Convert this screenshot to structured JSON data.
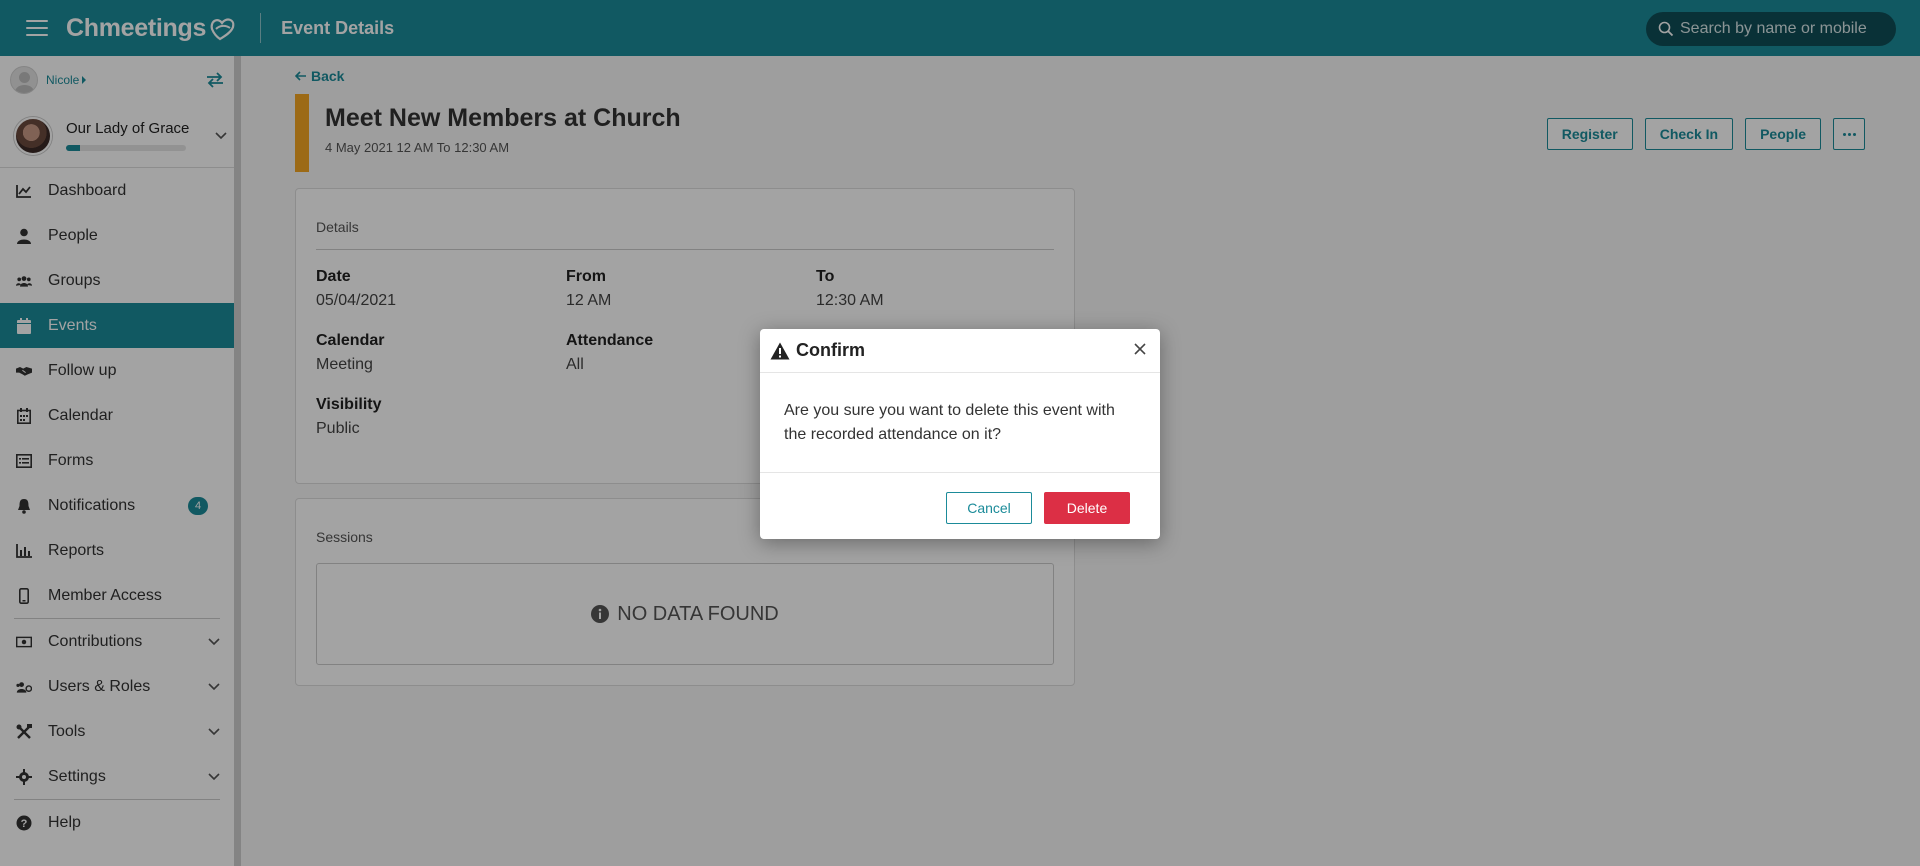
{
  "header": {
    "logo_text": "Chmeetings",
    "page_title": "Event Details",
    "search_placeholder": "Search by name or mobile"
  },
  "sidebar": {
    "user_name": "Nicole",
    "org_name": "Our Lady of Grace",
    "org_progress_percent": 12,
    "items": [
      {
        "label": "Dashboard",
        "icon": "chart-line-icon"
      },
      {
        "label": "People",
        "icon": "person-icon"
      },
      {
        "label": "Groups",
        "icon": "users-icon"
      },
      {
        "label": "Events",
        "icon": "calendar-icon",
        "active": true
      },
      {
        "label": "Follow up",
        "icon": "handshake-icon"
      },
      {
        "label": "Calendar",
        "icon": "calendar-grid-icon"
      },
      {
        "label": "Forms",
        "icon": "list-icon"
      },
      {
        "label": "Notifications",
        "icon": "bell-icon",
        "badge": "4"
      },
      {
        "label": "Reports",
        "icon": "bar-chart-icon"
      },
      {
        "label": "Member Access",
        "icon": "mobile-icon"
      },
      {
        "label": "Contributions",
        "icon": "money-icon"
      },
      {
        "label": "Users & Roles",
        "icon": "users-cog-icon"
      },
      {
        "label": "Tools",
        "icon": "tools-icon"
      },
      {
        "label": "Settings",
        "icon": "gear-icon"
      },
      {
        "label": "Help",
        "icon": "question-icon"
      }
    ]
  },
  "main": {
    "back_label": "Back",
    "event_title": "Meet New Members at Church",
    "event_subtitle": "4 May 2021 12 AM To 12:30 AM",
    "actions": {
      "register": "Register",
      "check_in": "Check In",
      "people": "People"
    },
    "details": {
      "heading": "Details",
      "date_label": "Date",
      "date_value": "05/04/2021",
      "from_label": "From",
      "from_value": "12 AM",
      "to_label": "To",
      "to_value": "12:30 AM",
      "calendar_label": "Calendar",
      "calendar_value": "Meeting",
      "attendance_label": "Attendance",
      "attendance_value": "All",
      "visibility_label": "Visibility",
      "visibility_value": "Public"
    },
    "sessions": {
      "heading": "Sessions",
      "empty_text": "NO DATA FOUND"
    }
  },
  "modal": {
    "title": "Confirm",
    "message": "Are you sure you want to delete this event with the recorded attendance on it?",
    "cancel_label": "Cancel",
    "delete_label": "Delete"
  },
  "colors": {
    "primary": "#1b8b99",
    "accent_bar": "#f5a623",
    "danger": "#dc2f45"
  }
}
